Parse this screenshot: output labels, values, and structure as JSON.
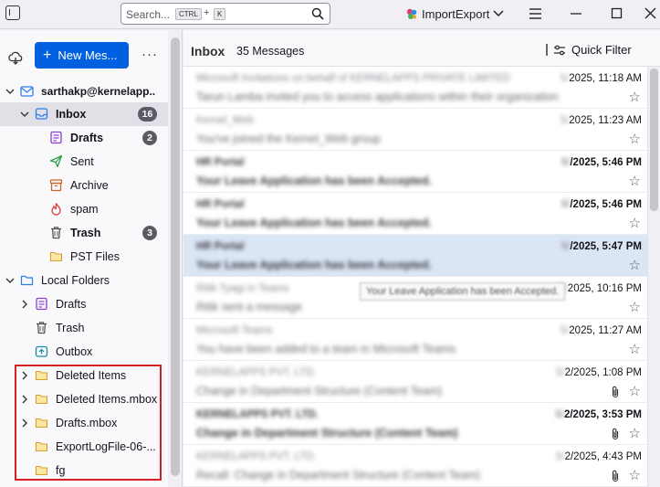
{
  "titlebar": {
    "search_placeholder": "Search...",
    "kbd_ctrl": "CTRL",
    "kbd_plus": "+",
    "kbd_k": "K",
    "extension_label": "ImportExport"
  },
  "folder_pane": {
    "new_message_label": "New Mes...",
    "new_message_plus": "+",
    "more_label": "···",
    "account_name": "sarthakp@kernelapp...",
    "folders": {
      "inbox": {
        "label": "Inbox",
        "badge": "16"
      },
      "drafts": {
        "label": "Drafts",
        "badge": "2"
      },
      "sent": {
        "label": "Sent"
      },
      "archive": {
        "label": "Archive"
      },
      "spam": {
        "label": "spam"
      },
      "trash": {
        "label": "Trash",
        "badge": "3"
      },
      "pst_files": {
        "label": "PST Files"
      }
    },
    "local_folders": {
      "label": "Local Folders",
      "drafts": "Drafts",
      "trash": "Trash",
      "outbox": "Outbox",
      "deleted_items": "Deleted Items",
      "deleted_items_mbox": "Deleted Items.mbox",
      "drafts_mbox": "Drafts.mbox",
      "export_log": "ExportLogFile-06-...",
      "fg": "fg"
    }
  },
  "message_list": {
    "title": "Inbox",
    "count": "35 Messages",
    "quick_filter_label": "Quick Filter",
    "tooltip": "Your Leave Application has been Accepted.",
    "messages": [
      {
        "sender": "Microsoft Invitations on behalf of KERNELAPPS PRIVATE LIMITED",
        "subject": "Tarun Lamba invited you to access applications within their organization",
        "date_blur": "5/",
        "date": "2025, 11:18 AM",
        "unread": false,
        "attachment": false
      },
      {
        "sender": "Kernel_Web",
        "subject": "You've joined the Kernel_Web group",
        "date_blur": "5/",
        "date": "2025, 11:23 AM",
        "unread": false,
        "attachment": false
      },
      {
        "sender": "HR Portal",
        "subject": "Your Leave Application has been Accepted.",
        "date_blur": "5/",
        "date": "/2025, 5:46 PM",
        "unread": true,
        "attachment": false
      },
      {
        "sender": "HR Portal",
        "subject": "Your Leave Application has been Accepted.",
        "date_blur": "5/",
        "date": "/2025, 5:46 PM",
        "unread": true,
        "attachment": false
      },
      {
        "sender": "HR Portal",
        "subject": "Your Leave Application has been Accepted.",
        "date_blur": "5/",
        "date": "/2025, 5:47 PM",
        "unread": true,
        "attachment": false
      },
      {
        "sender": "Ritik Tyagi in Teams",
        "subject": "Ritik sent a message",
        "date_blur": "5/",
        "date": "2025, 10:16 PM",
        "unread": false,
        "attachment": false
      },
      {
        "sender": "Microsoft Teams",
        "subject": "You have been added to a team in Microsoft Teams",
        "date_blur": "5/",
        "date": "2025, 11:27 AM",
        "unread": false,
        "attachment": false
      },
      {
        "sender": "KERNELAPPS PVT. LTD.",
        "subject": "Change in Department Structure (Content Team)",
        "date_blur": "5/",
        "date": "2/2025, 1:08 PM",
        "unread": false,
        "attachment": true
      },
      {
        "sender": "KERNELAPPS PVT. LTD.",
        "subject": "Change in Department Structure (Content Team)",
        "date_blur": "5/",
        "date": "2/2025, 3:53 PM",
        "unread": true,
        "attachment": true
      },
      {
        "sender": "KERNELAPPS PVT. LTD.",
        "subject": "Recall: Change in Department Structure (Content Team)",
        "date_blur": "5/",
        "date": "2/2025, 4:43 PM",
        "unread": false,
        "attachment": true
      }
    ]
  },
  "colors": {
    "accent": "#0061e0",
    "selection": "#dbe6f5",
    "highlight_border": "#d42020",
    "folder_yellow": "#f2c94c"
  }
}
